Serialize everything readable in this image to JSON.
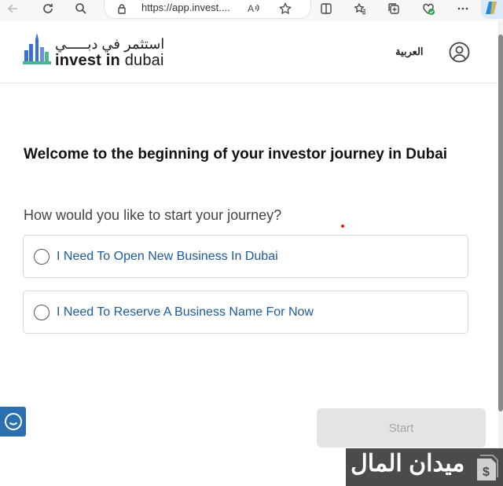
{
  "browser": {
    "url": "https://app.invest...."
  },
  "header": {
    "logo_arabic": "استثمر في دبـــــي",
    "logo_english_bold": "invest in",
    "logo_english_light": " dubai",
    "language_link": "العربية"
  },
  "main": {
    "title": "Welcome to the beginning of your investor journey in Dubai",
    "question": "How would you like to start your journey?",
    "options": [
      {
        "label": "I Need To Open New Business In Dubai",
        "selected": false
      },
      {
        "label": "I Need To Reserve A Business Name For Now",
        "selected": false
      }
    ],
    "start_button": "Start",
    "start_enabled": false
  },
  "watermark": {
    "text": "ميدان المال"
  },
  "colors": {
    "option_text": "#1c5a99",
    "chat_widget": "#2a6fb0",
    "button_disabled_bg": "#e4e4e4",
    "logo_blue": "#3b6fd6",
    "logo_green": "#4bb78a"
  }
}
